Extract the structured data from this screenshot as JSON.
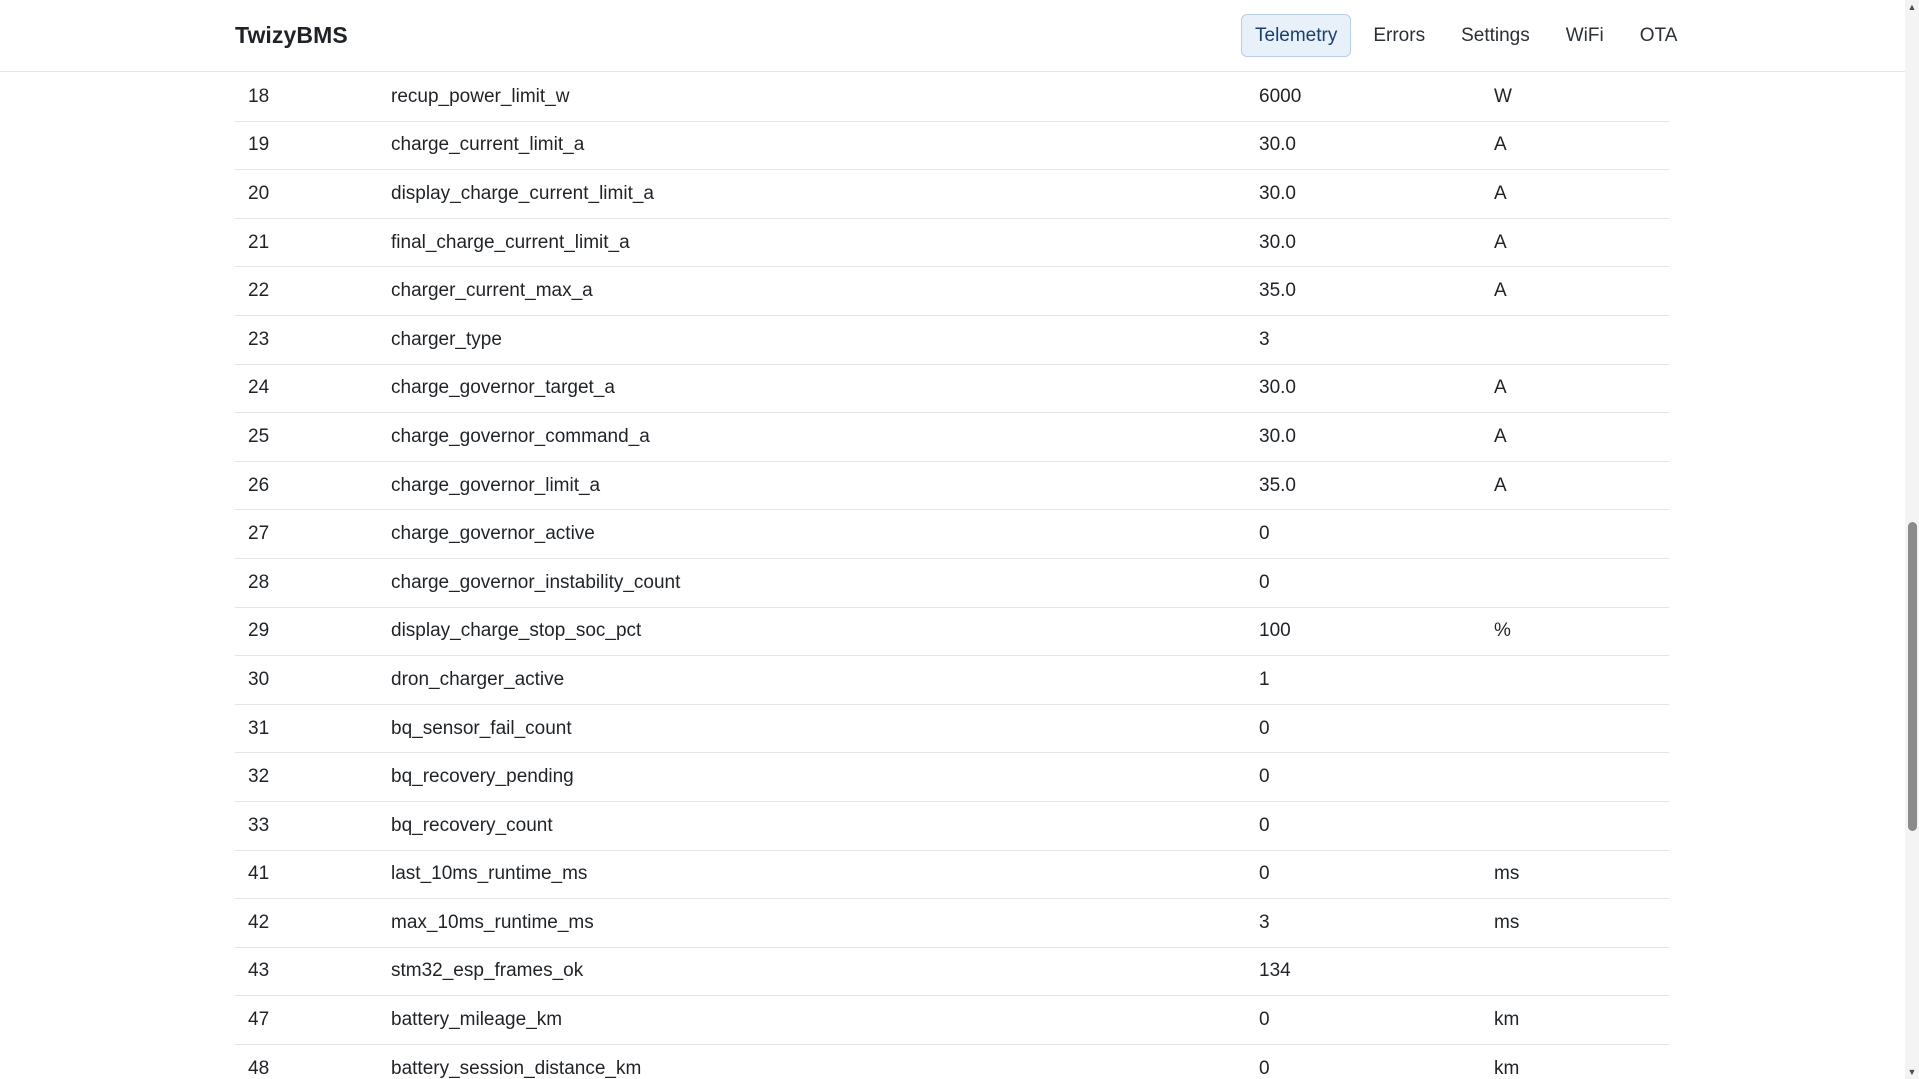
{
  "header": {
    "brand": "TwizyBMS",
    "nav": [
      {
        "label": "Telemetry",
        "active": true
      },
      {
        "label": "Errors",
        "active": false
      },
      {
        "label": "Settings",
        "active": false
      },
      {
        "label": "WiFi",
        "active": false
      },
      {
        "label": "OTA",
        "active": false
      }
    ]
  },
  "telemetry": {
    "rows": [
      {
        "id": "18",
        "name": "recup_power_limit_w",
        "value": "6000",
        "unit": "W"
      },
      {
        "id": "19",
        "name": "charge_current_limit_a",
        "value": "30.0",
        "unit": "A"
      },
      {
        "id": "20",
        "name": "display_charge_current_limit_a",
        "value": "30.0",
        "unit": "A"
      },
      {
        "id": "21",
        "name": "final_charge_current_limit_a",
        "value": "30.0",
        "unit": "A"
      },
      {
        "id": "22",
        "name": "charger_current_max_a",
        "value": "35.0",
        "unit": "A"
      },
      {
        "id": "23",
        "name": "charger_type",
        "value": "3",
        "unit": ""
      },
      {
        "id": "24",
        "name": "charge_governor_target_a",
        "value": "30.0",
        "unit": "A"
      },
      {
        "id": "25",
        "name": "charge_governor_command_a",
        "value": "30.0",
        "unit": "A"
      },
      {
        "id": "26",
        "name": "charge_governor_limit_a",
        "value": "35.0",
        "unit": "A"
      },
      {
        "id": "27",
        "name": "charge_governor_active",
        "value": "0",
        "unit": ""
      },
      {
        "id": "28",
        "name": "charge_governor_instability_count",
        "value": "0",
        "unit": ""
      },
      {
        "id": "29",
        "name": "display_charge_stop_soc_pct",
        "value": "100",
        "unit": "%"
      },
      {
        "id": "30",
        "name": "dron_charger_active",
        "value": "1",
        "unit": ""
      },
      {
        "id": "31",
        "name": "bq_sensor_fail_count",
        "value": "0",
        "unit": ""
      },
      {
        "id": "32",
        "name": "bq_recovery_pending",
        "value": "0",
        "unit": ""
      },
      {
        "id": "33",
        "name": "bq_recovery_count",
        "value": "0",
        "unit": ""
      },
      {
        "id": "41",
        "name": "last_10ms_runtime_ms",
        "value": "0",
        "unit": "ms"
      },
      {
        "id": "42",
        "name": "max_10ms_runtime_ms",
        "value": "3",
        "unit": "ms"
      },
      {
        "id": "43",
        "name": "stm32_esp_frames_ok",
        "value": "134",
        "unit": ""
      },
      {
        "id": "47",
        "name": "battery_mileage_km",
        "value": "0",
        "unit": "km"
      },
      {
        "id": "48",
        "name": "battery_session_distance_km",
        "value": "0",
        "unit": "km"
      }
    ]
  },
  "scrollbar": {
    "up_icon": "scroll-up-arrow-icon",
    "down_icon": "scroll-down-arrow-icon"
  }
}
